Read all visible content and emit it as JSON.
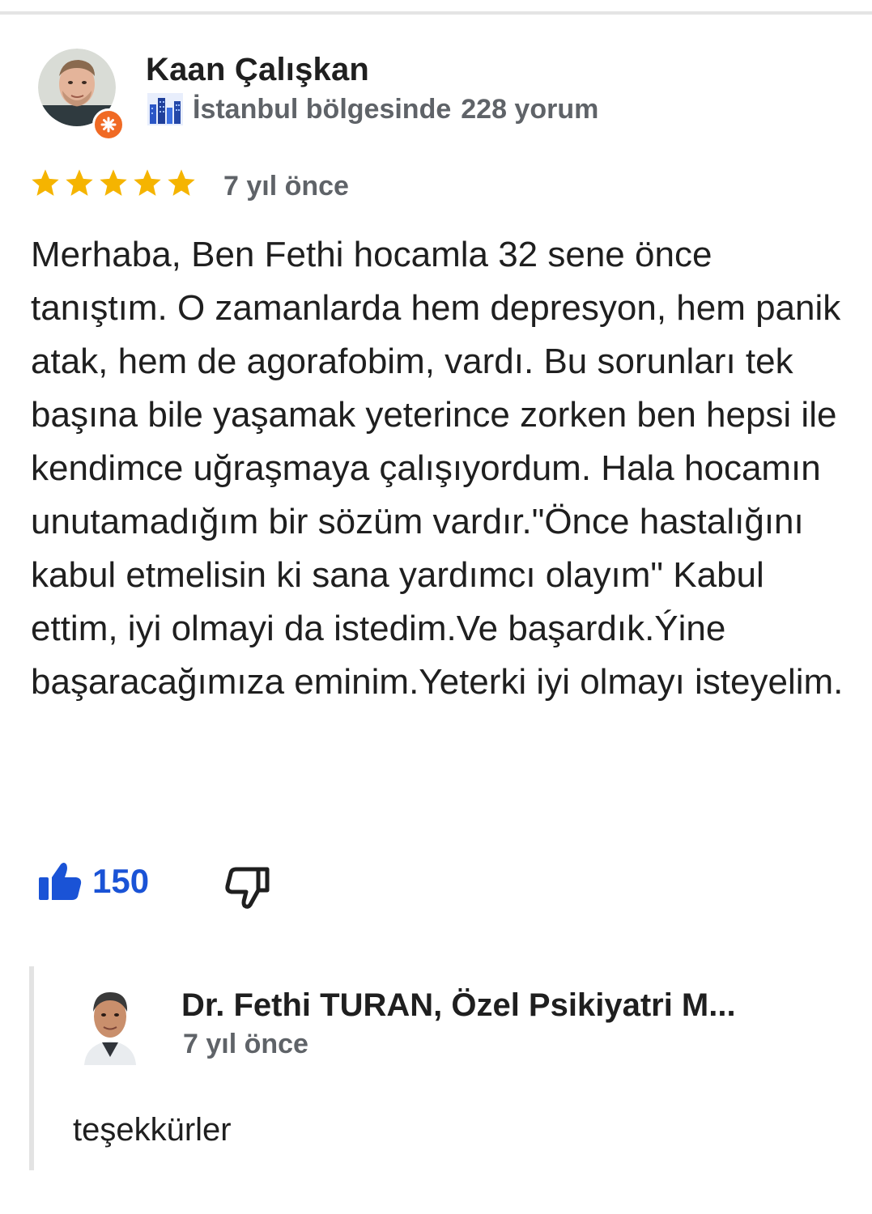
{
  "review": {
    "reviewer_name": "Kaan Çalışkan",
    "region_text": "İstanbul bölgesinde",
    "review_count_text": "228 yorum",
    "rating": 5,
    "rating_max": 5,
    "star_color": "#f5b400",
    "date": "7 yıl önce",
    "text": "Merhaba, Ben Fethi hocamla 32 sene önce tanıştım. O zamanlarda hem depresyon, hem panik atak,  hem de agorafobim, vardı. Bu sorunları tek başına bile yaşamak yeterince zorken ben hepsi ile kendimce uğraşmaya çalışıyordum. Hala hocamın unutamadığım  bir sözüm vardır.\"Önce hastalığını kabul etmelisin ki sana yardımcı olayım\" Kabul ettim, iyi olmayi da istedim.Ve başardık.Ýine başaracağımıza eminim.Yeterki iyi olmayı isteyelim.",
    "icons": {
      "avatar": "user-avatar",
      "badge": "local-guide-badge-icon",
      "city": "city-buildings-icon",
      "like": "thumbs-up-filled-icon",
      "dislike": "thumbs-down-outline-icon"
    }
  },
  "reactions": {
    "like_count": "150",
    "like_color": "#1a53d6"
  },
  "owner_response": {
    "name": "Dr. Fethi TURAN, Özel Psikiyatri M...",
    "date": "7 yıl önce",
    "text": "teşekkürler"
  },
  "colors": {
    "badge_orange": "#f06a24",
    "secondary_text": "#5f6368",
    "primary_text": "#1f1f1f"
  }
}
